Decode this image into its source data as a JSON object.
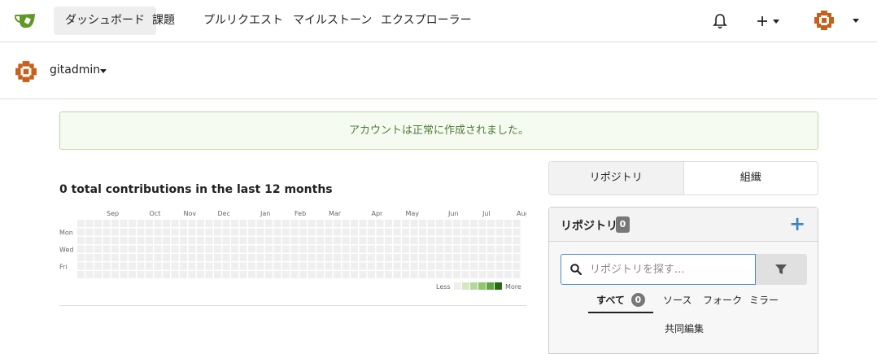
{
  "nav": {
    "items": [
      "ダッシュボード",
      "課題",
      "プルリクエスト",
      "マイルストーン",
      "エクスプローラー"
    ]
  },
  "context": {
    "username": "gitadmin"
  },
  "flash": {
    "message": "アカウントは正常に作成されました。"
  },
  "heatmap": {
    "title": "0 total contributions in the last 12 months",
    "months": [
      "Sep",
      "Oct",
      "Nov",
      "Dec",
      "Jan",
      "Feb",
      "Mar",
      "Apr",
      "May",
      "Jun",
      "Jul",
      "Aug"
    ],
    "days": [
      "Mon",
      "Wed",
      "Fri"
    ],
    "legend_less": "Less",
    "legend_more": "More",
    "empty_color": "#efefef",
    "scale_colors": [
      "#efefef",
      "#d6e8c1",
      "#b5d79b",
      "#8fc56f",
      "#5fa540",
      "#276a12"
    ]
  },
  "right": {
    "seg_repos": "リポジトリ",
    "seg_orgs": "組織",
    "panel_title": "リポジトリ",
    "panel_count": "0",
    "search_placeholder": "リポジトリを探す...",
    "tabs": {
      "all": "すべて",
      "all_count": "0",
      "sources": "ソース",
      "forks": "フォーク",
      "mirrors": "ミラー",
      "collab": "共同編集"
    }
  },
  "colors": {
    "accent": "#3f83c5",
    "success_bg": "#f6fbf2",
    "success_text": "#4d7c33",
    "logo_green": "#609926",
    "avatar_orange": "#c85f1a"
  }
}
